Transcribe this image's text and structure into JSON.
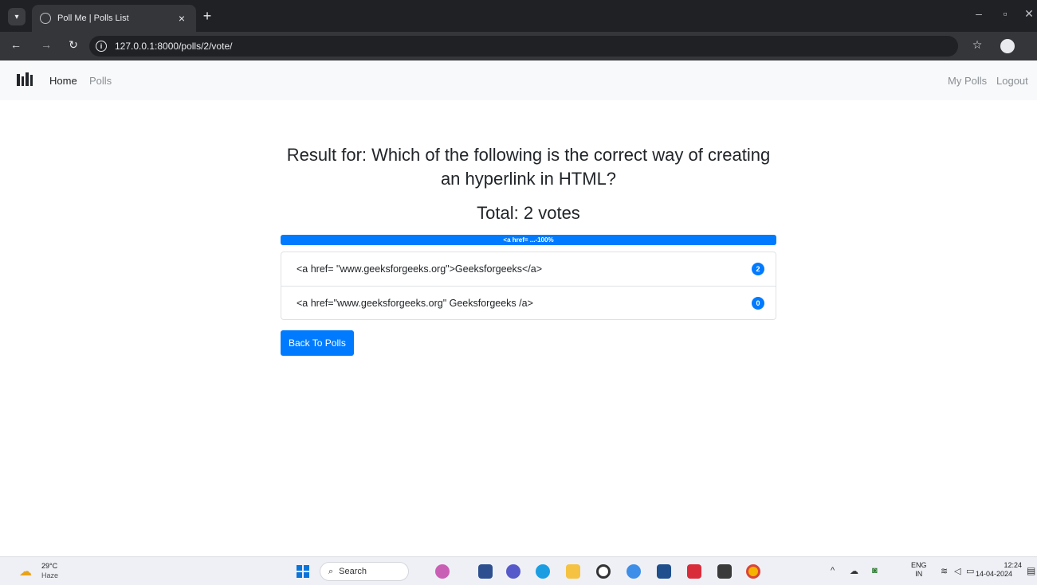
{
  "browser": {
    "tab_title": "Poll Me | Polls List",
    "url": "127.0.0.1:8000/polls/2/vote/"
  },
  "navbar": {
    "home": "Home",
    "polls": "Polls",
    "my_polls": "My Polls",
    "logout": "Logout"
  },
  "result": {
    "title": "Result for: Which of the following is the correct way of creating an hyperlink in HTML?",
    "total": "Total: 2 votes",
    "progress_label": "<a href= ...-100%",
    "progress_percent": 100,
    "choices": [
      {
        "text": "<a href= \"www.geeksforgeeks.org\">Geeksforgeeks</a>",
        "votes": "2"
      },
      {
        "text": "<a href=\"www.geeksforgeeks.org\" Geeksforgeeks /a>",
        "votes": "0"
      }
    ],
    "back_button": "Back To Polls"
  },
  "taskbar": {
    "temperature": "29°C",
    "weather": "Haze",
    "search": "Search",
    "lang_top": "ENG",
    "lang_bottom": "IN",
    "time": "12:24",
    "date": "14-04-2024"
  },
  "colors": {
    "primary": "#007bff",
    "navbar_bg": "#f8f9fa",
    "chrome_dark": "#202124"
  }
}
